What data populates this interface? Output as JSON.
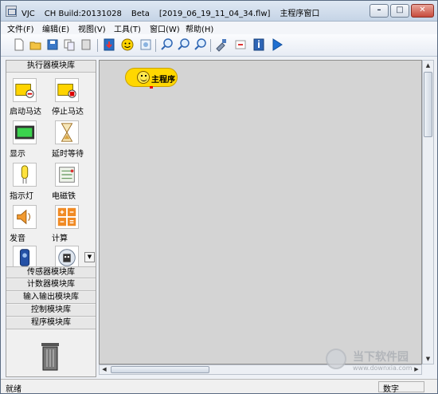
{
  "window": {
    "app_name": "VJC",
    "build": "CH Build:20131028",
    "edition": "Beta",
    "file": "[2019_06_19_11_04_34.flw]",
    "view": "主程序窗口",
    "controls": {
      "minimize": "–",
      "maximize": "□",
      "close": "✕"
    }
  },
  "menubar": [
    "文件(F)",
    "编辑(E)",
    "视图(V)",
    "工具(T)",
    "窗口(W)",
    "帮助(H)"
  ],
  "toolbar": [
    "new-icon",
    "open-icon",
    "save-icon",
    "copy-icon",
    "paste-icon",
    "download-icon",
    "smiley-icon",
    "page-icon",
    "zoom-in-icon",
    "zoom-out-icon",
    "zoom-icon",
    "tools-icon",
    "convert-icon",
    "info-icon",
    "run-icon"
  ],
  "library": {
    "active_title": "执行器模块库",
    "tools": [
      {
        "label": "启动马达",
        "icon": "start-motor-icon"
      },
      {
        "label": "停止马达",
        "icon": "stop-motor-icon"
      },
      {
        "label": "显示",
        "icon": "display-icon"
      },
      {
        "label": "延时等待",
        "icon": "hourglass-icon"
      },
      {
        "label": "指示灯",
        "icon": "lamp-icon"
      },
      {
        "label": "电磁铁",
        "icon": "electromagnet-icon"
      },
      {
        "label": "发音",
        "icon": "speaker-icon"
      },
      {
        "label": "计算",
        "icon": "calculator-icon"
      },
      {
        "label": "",
        "icon": "remote-icon"
      },
      {
        "label": "",
        "icon": "robot-icon"
      }
    ],
    "sections": [
      "传感器模块库",
      "计数器模块库",
      "输入输出模块库",
      "控制模块库",
      "程序模块库"
    ],
    "scroll_down": "▼",
    "trash": "trash-icon"
  },
  "canvas": {
    "main_block": "主程序"
  },
  "scrollbars": {
    "up": "▲",
    "down": "▼",
    "left": "◀",
    "right": "▶"
  },
  "status": {
    "left": "就绪",
    "right": "数字"
  },
  "watermark": {
    "title": "当下软件园",
    "url": "www.downxia.com"
  },
  "colors": {
    "canvas": "#d4d4d4",
    "main_block": "#ffd700",
    "port": "#ee0000"
  }
}
